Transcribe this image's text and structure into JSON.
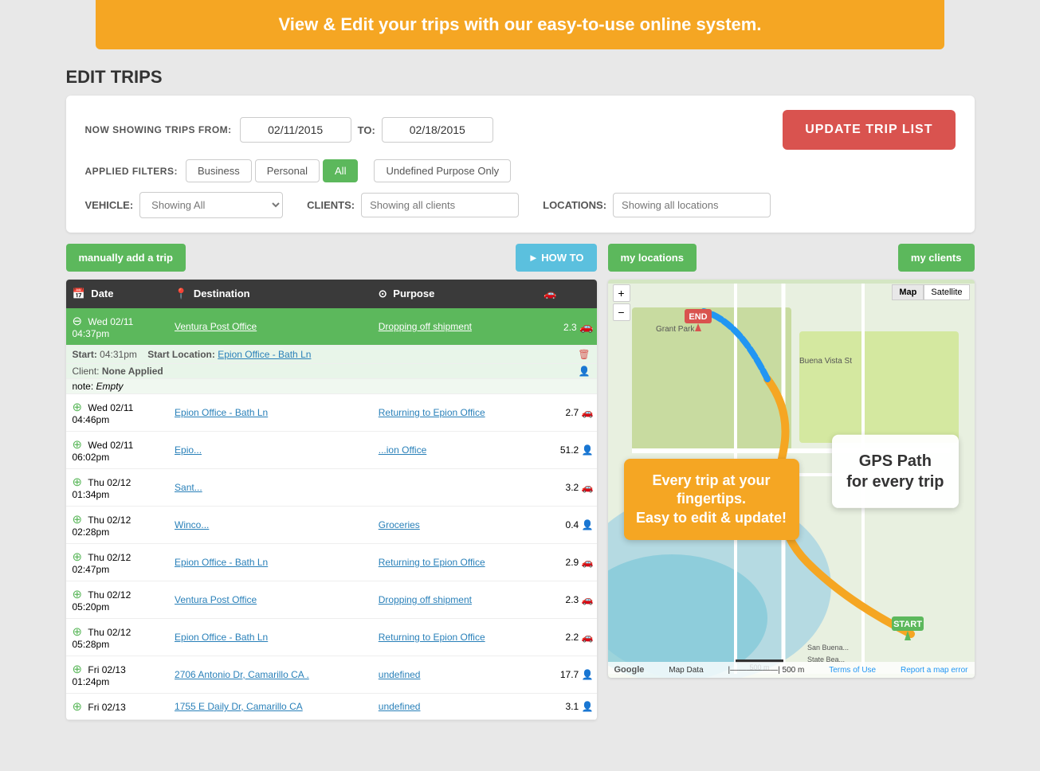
{
  "banner": {
    "text": "View & Edit your trips with our easy-to-use online system."
  },
  "page": {
    "title": "EDIT TRIPS"
  },
  "filters": {
    "showing_from_label": "NOW SHOWING TRIPS FROM:",
    "date_from": "02/11/2015",
    "to_label": "TO:",
    "date_to": "02/18/2015",
    "update_btn": "UPDATE TRIP LIST",
    "applied_filters_label": "Applied Filters:",
    "filter_buttons": [
      {
        "label": "Business",
        "active": false
      },
      {
        "label": "Personal",
        "active": false
      },
      {
        "label": "All",
        "active": true
      }
    ],
    "purpose_btn": "Undefined Purpose Only",
    "vehicle_label": "VEHICLE:",
    "vehicle_placeholder": "Showing All",
    "clients_label": "CLIENTS:",
    "clients_placeholder": "Showing all clients",
    "locations_label": "LOCATIONS:",
    "locations_placeholder": "Showing all locations"
  },
  "actions": {
    "add_trip_btn": "manually add a trip",
    "how_to_btn": "► HOW TO",
    "my_locations_btn": "my locations",
    "my_clients_btn": "my clients"
  },
  "table": {
    "headers": [
      "Date",
      "Destination",
      "Purpose",
      ""
    ],
    "rows": [
      {
        "type": "main",
        "expanded": true,
        "date": "Wed 02/11\n04:37pm",
        "destination": "Ventura Post Office",
        "purpose": "Dropping off shipment",
        "miles": "2.3",
        "icon": "car"
      },
      {
        "type": "detail",
        "start_time": "04:31pm",
        "start_location": "Epion Office - Bath Ln",
        "client": "None Applied",
        "note": "Empty"
      },
      {
        "type": "main",
        "expanded": false,
        "date": "Wed 02/11\n04:46pm",
        "destination": "Epion Office - Bath Ln",
        "purpose": "Returning to Epion Office",
        "miles": "2.7",
        "icon": "car"
      },
      {
        "type": "main",
        "expanded": false,
        "date": "Wed 02/11\n06:02pm",
        "destination": "Epio...",
        "purpose": "...ion Office",
        "miles": "51.2",
        "icon": "person"
      },
      {
        "type": "main",
        "expanded": false,
        "date": "Thu 02/12\n01:34pm",
        "destination": "Sant...",
        "purpose": "",
        "miles": "3.2",
        "icon": "car"
      },
      {
        "type": "main",
        "expanded": false,
        "date": "Thu 02/12\n02:28pm",
        "destination": "Winco...",
        "purpose": "Groceries",
        "miles": "0.4",
        "icon": "person"
      },
      {
        "type": "main",
        "expanded": false,
        "date": "Thu 02/12\n02:47pm",
        "destination": "Epion Office - Bath Ln",
        "purpose": "Returning to Epion Office",
        "miles": "2.9",
        "icon": "car"
      },
      {
        "type": "main",
        "expanded": false,
        "date": "Thu 02/12\n05:20pm",
        "destination": "Ventura Post Office",
        "purpose": "Dropping off shipment",
        "miles": "2.3",
        "icon": "car"
      },
      {
        "type": "main",
        "expanded": false,
        "date": "Thu 02/12\n05:28pm",
        "destination": "Epion Office - Bath Ln",
        "purpose": "Returning to Epion Office",
        "miles": "2.2",
        "icon": "car"
      },
      {
        "type": "main",
        "expanded": false,
        "date": "Fri 02/13\n01:24pm",
        "destination": "2706 Antonio Dr, Camarillo CA",
        "purpose": "undefined",
        "miles": "17.7",
        "icon": "person"
      },
      {
        "type": "main",
        "expanded": false,
        "date": "Fri 02/13",
        "destination": "1755 E Daily Dr, Camarillo CA",
        "purpose": "undefined",
        "miles": "3.1",
        "icon": "person"
      }
    ]
  },
  "map": {
    "controls": {
      "zoom_in": "+",
      "zoom_out": "−",
      "map_btn": "Map",
      "satellite_btn": "Satellite"
    },
    "overlay": {
      "gps_text": "GPS Path\nfor every trip"
    },
    "trip_overlay": {
      "text": "Every trip at your fingertips.\nEasy to edit & update!"
    },
    "footer": {
      "google": "Google",
      "map_data": "Map Data",
      "scale": "500 m",
      "terms": "Terms of Use",
      "report": "Report a map error"
    },
    "pins": {
      "end_label": "END",
      "start_label": "START"
    }
  }
}
